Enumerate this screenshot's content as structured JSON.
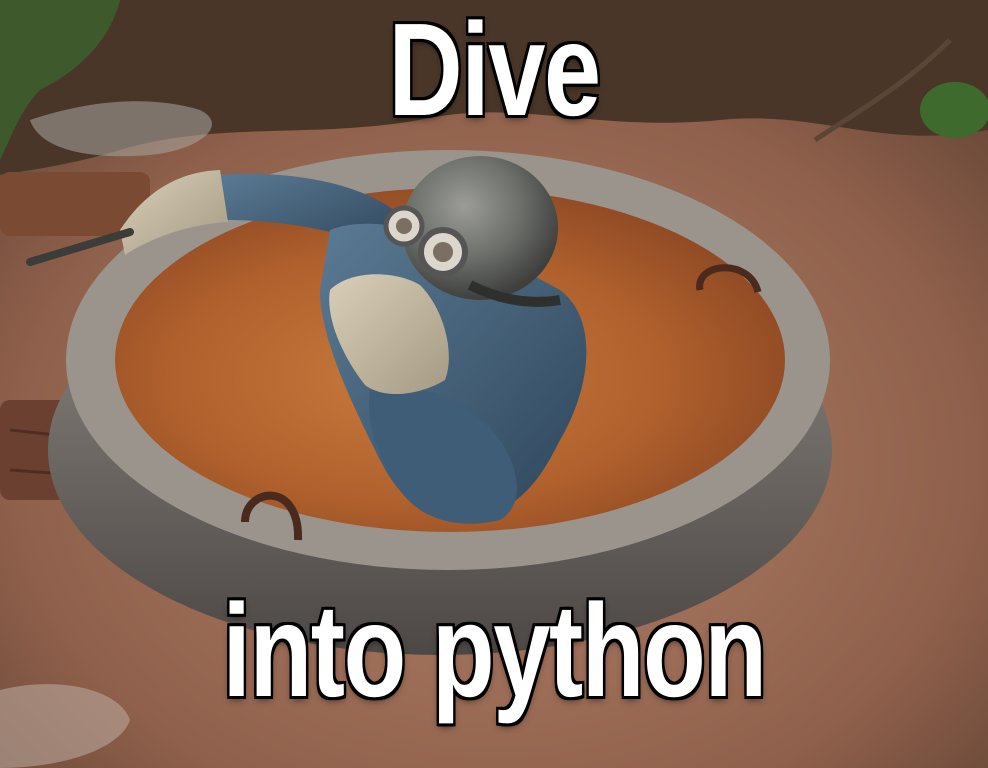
{
  "meme": {
    "top_text": "Dive",
    "bottom_text": "into python"
  },
  "colors": {
    "caption": "#ffffff",
    "caption_outline": "#000000",
    "water": "#b8642e",
    "concrete": "#8f8780",
    "suit": "#4a6b85",
    "helmet": "#6c6e6c",
    "mud": "#9a6e58"
  }
}
